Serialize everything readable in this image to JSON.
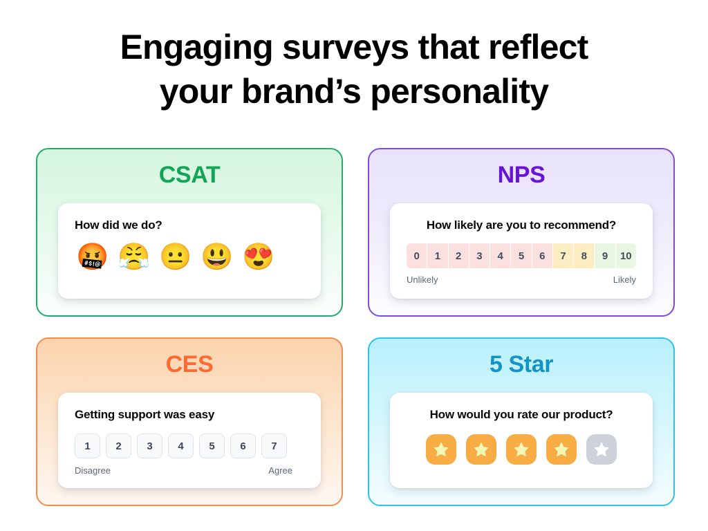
{
  "headline": {
    "line1": "Engaging surveys that reflect",
    "line2": "your brand’s personality"
  },
  "colors": {
    "csat_accent": "#12a555",
    "csat_border": "#22ab6a",
    "nps_accent": "#6714d6",
    "nps_border": "#8248dd",
    "ces_accent": "#fb6a33",
    "ces_border": "#f58b4c",
    "star_accent": "#1593c4",
    "star_border": "#2bc3e8",
    "nps_detractor": "#fbe0e0",
    "nps_passive": "#fdedc2",
    "nps_promoter": "#e9f7e2",
    "star_filled": "#f7ac44",
    "star_empty": "#ccd1da",
    "label_text": "#5c6678"
  },
  "cards": {
    "csat": {
      "title": "CSAT",
      "question": "How did we do?",
      "emojis": [
        {
          "glyph": "🤬",
          "name": "cursing-face-emoji"
        },
        {
          "glyph": "😤",
          "name": "face-with-steam-from-nose-emoji"
        },
        {
          "glyph": "😐",
          "name": "neutral-face-emoji"
        },
        {
          "glyph": "😃",
          "name": "grinning-face-emoji"
        },
        {
          "glyph": "😍",
          "name": "heart-eyes-face-emoji"
        }
      ]
    },
    "nps": {
      "title": "NPS",
      "question": "How likely are you to recommend?",
      "scale": [
        {
          "value": "0",
          "group": "detractor"
        },
        {
          "value": "1",
          "group": "detractor"
        },
        {
          "value": "2",
          "group": "detractor"
        },
        {
          "value": "3",
          "group": "detractor"
        },
        {
          "value": "4",
          "group": "detractor"
        },
        {
          "value": "5",
          "group": "detractor"
        },
        {
          "value": "6",
          "group": "detractor"
        },
        {
          "value": "7",
          "group": "passive"
        },
        {
          "value": "8",
          "group": "passive"
        },
        {
          "value": "9",
          "group": "promoter"
        },
        {
          "value": "10",
          "group": "promoter"
        }
      ],
      "low_label": "Unlikely",
      "high_label": "Likely"
    },
    "ces": {
      "title": "CES",
      "question": "Getting support was easy",
      "scale": [
        "1",
        "2",
        "3",
        "4",
        "5",
        "6",
        "7"
      ],
      "low_label": "Disagree",
      "high_label": "Agree"
    },
    "star": {
      "title": "5 Star",
      "question": "How would you rate our product?",
      "rating": 4,
      "max_rating": 5,
      "stars": [
        "filled",
        "filled",
        "filled",
        "filled",
        "empty"
      ]
    }
  }
}
